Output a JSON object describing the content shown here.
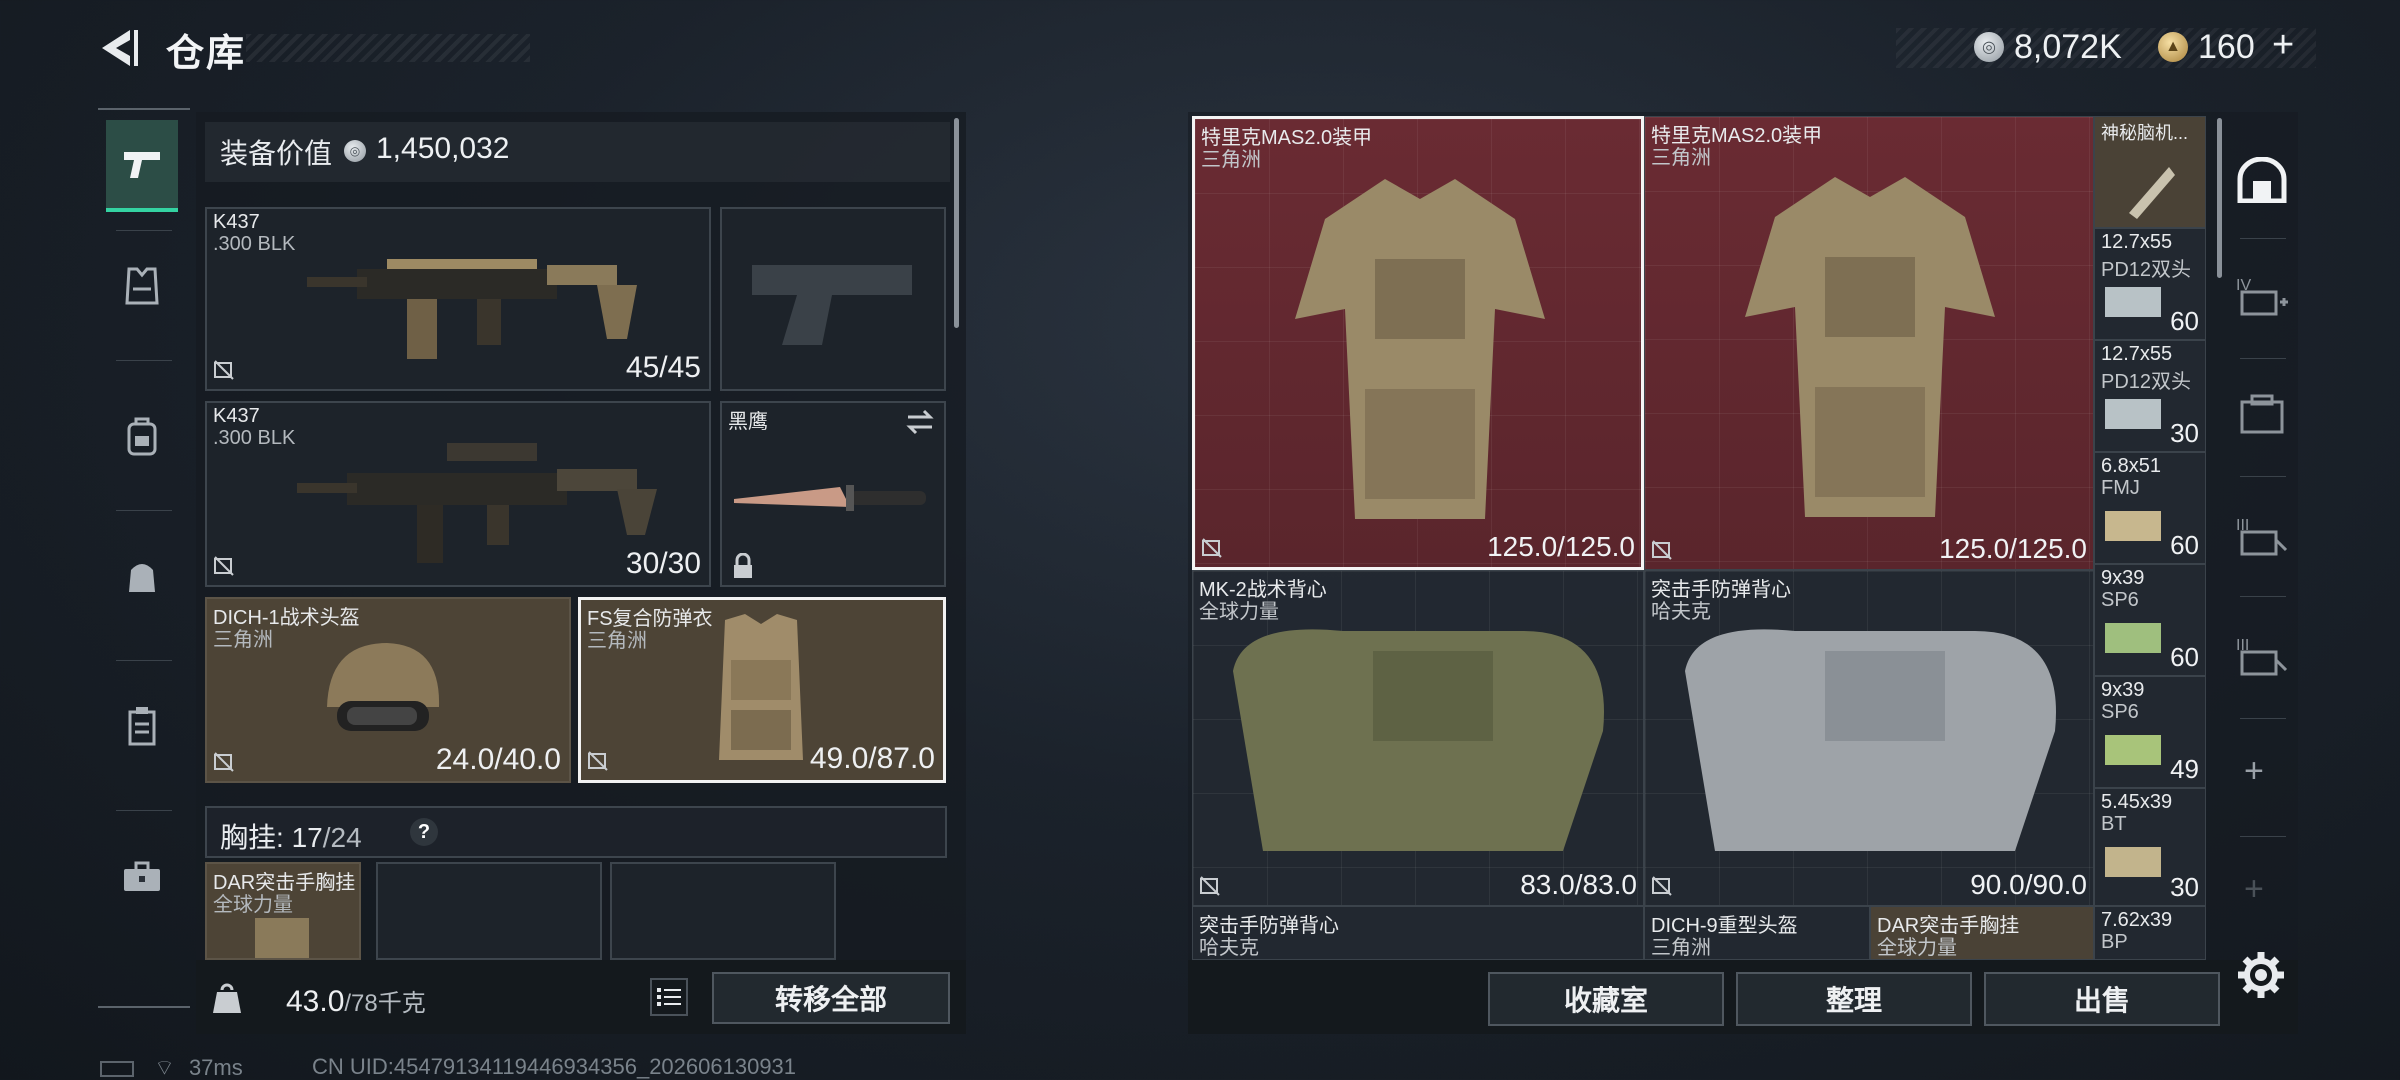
{
  "header": {
    "title": "仓库",
    "currencies": [
      {
        "icon": "silver-coin-icon",
        "value": "8,072K"
      },
      {
        "icon": "gold-coin-icon",
        "value": "160"
      }
    ],
    "plus": "+"
  },
  "nav": {
    "items": [
      "pistol-icon",
      "vest-icon",
      "backpack-icon",
      "pouch-icon",
      "case-icon",
      "toolbox-icon"
    ]
  },
  "loadout": {
    "value_label": "装备价值",
    "value": "1,450,032",
    "slots": [
      {
        "name": "K437",
        "sub": ".300 BLK",
        "value": "45/45"
      },
      {
        "name": "K437",
        "sub": ".300 BLK",
        "value": "30/30"
      },
      {
        "name": "黑鹰",
        "sub": "",
        "value": ""
      },
      {
        "name": "DICH-1战术头盔",
        "sub": "三角洲",
        "value": "24.0/40.0"
      },
      {
        "name": "FS复合防弹衣",
        "sub": "三角洲",
        "value": "49.0/87.0"
      }
    ],
    "chest_label": "胸挂:",
    "chest_used": "17",
    "chest_total": "/24",
    "help": "?",
    "chest_item": {
      "name": "DAR突击手胸挂",
      "sub": "全球力量"
    },
    "weight": "43.0",
    "weight_max": "/78千克",
    "transfer_all": "转移全部"
  },
  "stash": {
    "items": [
      {
        "name": "特里克MAS2.0装甲",
        "sub": "三角洲",
        "value": "125.0/125.0"
      },
      {
        "name": "特里克MAS2.0装甲",
        "sub": "三角洲",
        "value": "125.0/125.0"
      },
      {
        "name": "MK-2战术背心",
        "sub": "全球力量",
        "value": "83.0/83.0"
      },
      {
        "name": "突击手防弹背心",
        "sub": "哈夫克",
        "value": "90.0/90.0"
      },
      {
        "name": "突击手防弹背心",
        "sub": "哈夫克"
      },
      {
        "name": "DICH-9重型头盔",
        "sub": "三角洲"
      },
      {
        "name": "DAR突击手胸挂",
        "sub": "全球力量"
      }
    ],
    "small": [
      {
        "name": "神秘脑机...",
        "sub": "",
        "amount": ""
      },
      {
        "name": "12.7x55",
        "sub": "PD12双头",
        "amount": "60"
      },
      {
        "name": "12.7x55",
        "sub": "PD12双头",
        "amount": "30"
      },
      {
        "name": "6.8x51",
        "sub": "FMJ",
        "amount": "60"
      },
      {
        "name": "9x39",
        "sub": "SP6",
        "amount": "60"
      },
      {
        "name": "9x39",
        "sub": "SP6",
        "amount": "49"
      },
      {
        "name": "5.45x39",
        "sub": "BT",
        "amount": "30"
      },
      {
        "name": "7.62x39",
        "sub": "BP",
        "amount": ""
      }
    ],
    "buttons": {
      "collection": "收藏室",
      "sort": "整理",
      "sell": "出售"
    }
  },
  "side_tools": {
    "plus1": "+",
    "plus2": "+"
  },
  "status": {
    "ping": "37ms",
    "uid": "CN UID:4547913411944693435​6_202606130931"
  },
  "colors": {
    "accent": "#34d3a2",
    "selected_border": "#f4f4f4",
    "red_cell": "#6a2b33",
    "tan_cell": "#4d4436"
  }
}
